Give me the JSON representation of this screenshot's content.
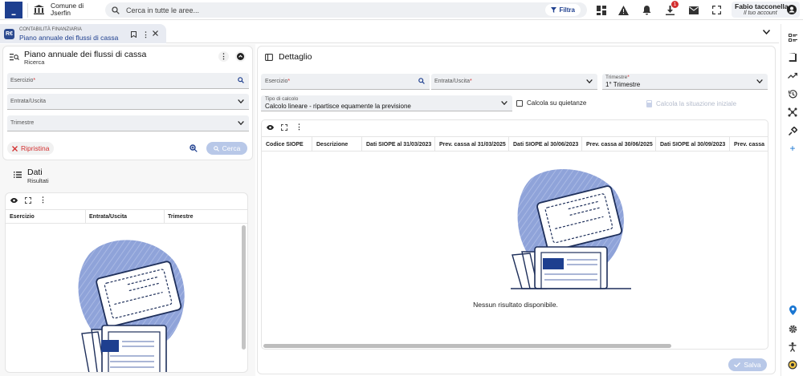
{
  "header": {
    "org_line1": "Comune di",
    "org_line2": "Jserfin",
    "search_placeholder": "Cerca in tutte le aree...",
    "filter_label": "Filtra",
    "notification_count": "1",
    "user_name": "Fabio tacconella",
    "user_link": "Il tuo account"
  },
  "tab": {
    "module": "CONTABILITÀ FINANZIARIA",
    "title": "Piano annuale dei flussi di cassa"
  },
  "left": {
    "title": "Piano annuale dei flussi di cassa",
    "subtitle": "Ricerca",
    "fields": {
      "esercizio": "Esercizio",
      "entrata_uscita": "Entrata/Uscita",
      "trimestre": "Trimestre"
    },
    "reset_label": "Ripristina",
    "search_label": "Cerca",
    "results_title": "Dati",
    "results_subtitle": "Risultati",
    "columns": [
      "Esercizio",
      "Entrata/Uscita",
      "Trimestre"
    ]
  },
  "right": {
    "title": "Dettaglio",
    "fields": {
      "esercizio": "Esercizio",
      "entrata_uscita": "Entrata/Uscita",
      "trimestre_label": "Trimestre",
      "trimestre_value": "1° Trimestre",
      "tipo_label": "Tipo di calcolo",
      "tipo_value": "Calcolo lineare - ripartisce equamente la previsione"
    },
    "checkbox_label": "Calcola su quietanze",
    "calc_button": "Calcola la situazione iniziale",
    "columns": [
      "Codice SIOPE",
      "Descrizione",
      "Dati SIOPE al 31/03/2023",
      "Prev. cassa al 31/03/2025",
      "Dati SIOPE al 30/06/2023",
      "Prev. cassa al 30/06/2025",
      "Dati SIOPE al 30/09/2023",
      "Prev. cassa"
    ],
    "empty_message": "Nessun risultato disponibile.",
    "save_label": "Salva"
  },
  "colors": {
    "brand": "#1e3f8f",
    "accent_blob": "#8fa3d9",
    "required": "#d32f2f",
    "location": "#1976d2"
  }
}
